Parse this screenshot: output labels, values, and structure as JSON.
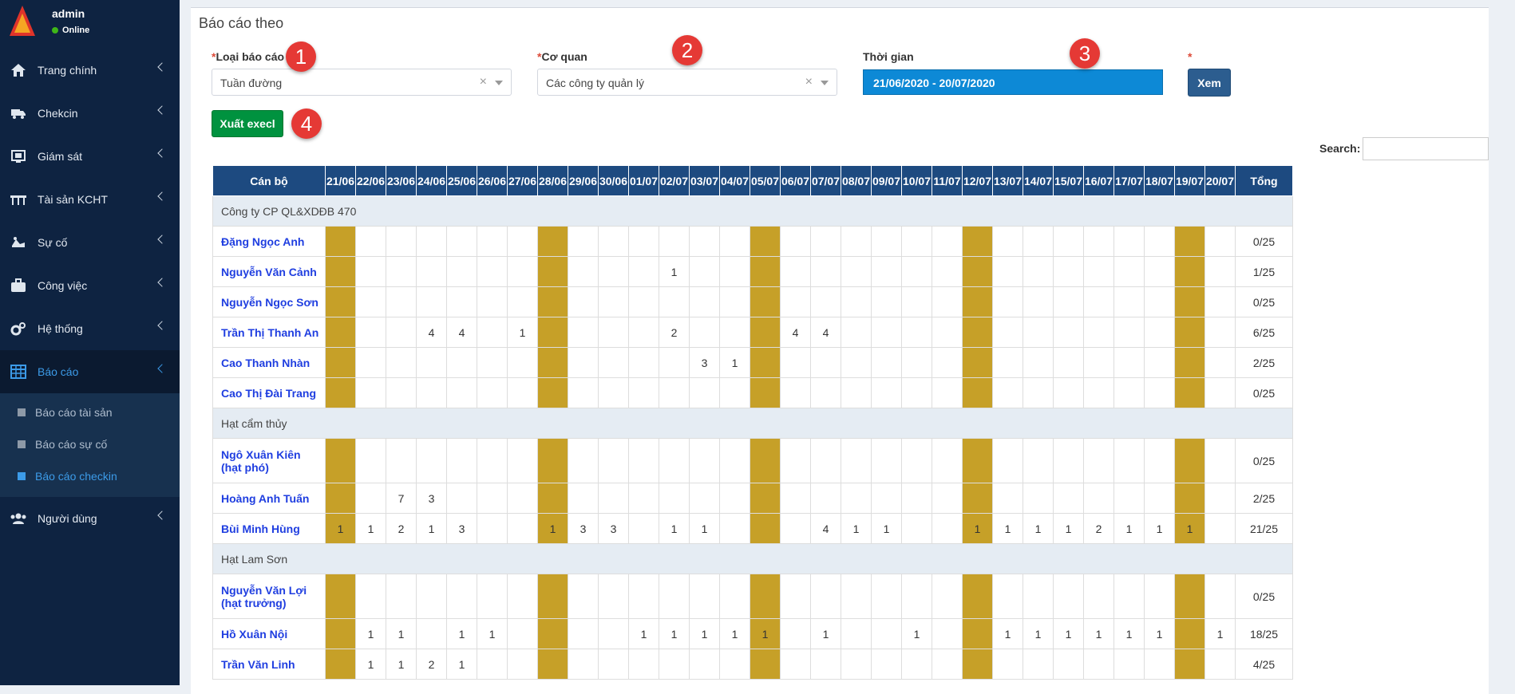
{
  "sidebar": {
    "user": {
      "name": "admin",
      "status": "Online"
    },
    "menu": [
      {
        "label": "Trang chính",
        "icon": "home-icon"
      },
      {
        "label": "Chekcin",
        "icon": "truck-icon"
      },
      {
        "label": "Giám sát",
        "icon": "monitor-icon"
      },
      {
        "label": "Tài sản KCHT",
        "icon": "bridge-icon"
      },
      {
        "label": "Sự cố",
        "icon": "accident-icon"
      },
      {
        "label": "Công việc",
        "icon": "briefcase-icon"
      },
      {
        "label": "Hệ thống",
        "icon": "cogs-icon"
      },
      {
        "label": "Báo cáo",
        "icon": "table-icon"
      },
      {
        "label": "Người dùng",
        "icon": "users-icon"
      }
    ],
    "report_submenu": [
      "Báo cáo tài sản",
      "Báo cáo sự cố",
      "Báo cáo checkin"
    ]
  },
  "box": {
    "title": "Báo cáo theo"
  },
  "filters": {
    "report_type": {
      "label": "Loại báo cáo",
      "value": "Tuần đường"
    },
    "agency": {
      "label": "Cơ quan",
      "value": "Các công ty quản lý"
    },
    "time": {
      "label": "Thời gian",
      "value": "21/06/2020 - 20/07/2020"
    },
    "view_button": "Xem",
    "export_button": "Xuất execl",
    "required_mark": "*",
    "clear_mark": "×"
  },
  "badges": [
    "1",
    "2",
    "3",
    "4"
  ],
  "search": {
    "label": "Search:"
  },
  "table": {
    "name_header": "Cán bộ",
    "total_header": "Tổng",
    "dates": [
      "21/06",
      "22/06",
      "23/06",
      "24/06",
      "25/06",
      "26/06",
      "27/06",
      "28/06",
      "29/06",
      "30/06",
      "01/07",
      "02/07",
      "03/07",
      "04/07",
      "05/07",
      "06/07",
      "07/07",
      "08/07",
      "09/07",
      "10/07",
      "11/07",
      "12/07",
      "13/07",
      "14/07",
      "15/07",
      "16/07",
      "17/07",
      "18/07",
      "19/07",
      "20/07"
    ],
    "holiday_cols": [
      0,
      7,
      14,
      21,
      28
    ],
    "rows": [
      {
        "group": "Công ty CP QL&XDĐB 470"
      },
      {
        "name": "Đặng Ngọc Anh",
        "vals": {},
        "total": "0/25"
      },
      {
        "name": "Nguyễn Văn Cảnh",
        "vals": {
          "11": "1"
        },
        "total": "1/25"
      },
      {
        "name": "Nguyễn Ngọc Sơn",
        "vals": {},
        "total": "0/25"
      },
      {
        "name": "Trần Thị Thanh An",
        "vals": {
          "3": "4",
          "4": "4",
          "6": "1",
          "11": "2",
          "15": "4",
          "16": "4"
        },
        "total": "6/25"
      },
      {
        "name": "Cao Thanh Nhàn",
        "vals": {
          "12": "3",
          "13": "1"
        },
        "total": "2/25"
      },
      {
        "name": "Cao Thị Đài Trang",
        "vals": {},
        "total": "0/25"
      },
      {
        "group": "Hạt cẩm thủy"
      },
      {
        "name": "Ngô Xuân Kiên",
        "name2": "(hạt phó)",
        "vals": {},
        "total": "0/25"
      },
      {
        "name": "Hoàng Anh Tuấn",
        "vals": {
          "2": "7",
          "3": "3"
        },
        "total": "2/25"
      },
      {
        "name": "Bùi Minh Hùng",
        "vals": {
          "0": "1",
          "1": "1",
          "2": "2",
          "3": "1",
          "4": "3",
          "7": "1",
          "8": "3",
          "9": "3",
          "11": "1",
          "12": "1",
          "16": "4",
          "17": "1",
          "18": "1",
          "21": "1",
          "22": "1",
          "23": "1",
          "24": "1",
          "25": "2",
          "26": "1",
          "27": "1",
          "28": "1"
        },
        "total": "21/25"
      },
      {
        "group": "Hạt Lam Sơn"
      },
      {
        "name": "Nguyễn Văn Lợi",
        "name2": "(hạt trưởng)",
        "vals": {},
        "total": "0/25"
      },
      {
        "name": "Hồ Xuân Nội",
        "vals": {
          "1": "1",
          "2": "1",
          "4": "1",
          "5": "1",
          "10": "1",
          "11": "1",
          "12": "1",
          "13": "1",
          "14": "1",
          "16": "1",
          "19": "1",
          "22": "1",
          "23": "1",
          "24": "1",
          "25": "1",
          "26": "1",
          "27": "1",
          "29": "1"
        },
        "total": "18/25"
      },
      {
        "name": "Trần Văn Linh",
        "vals": {
          "1": "1",
          "2": "1",
          "3": "2",
          "4": "1"
        },
        "total": "4/25"
      }
    ]
  },
  "colors": {
    "sidebar": "#0e2341",
    "header": "#1d4a80",
    "holiday": "#c6a028",
    "export": "#00923f",
    "badge": "#e53935",
    "link": "#1f3ee0",
    "date_picker": "#0d89d6"
  }
}
